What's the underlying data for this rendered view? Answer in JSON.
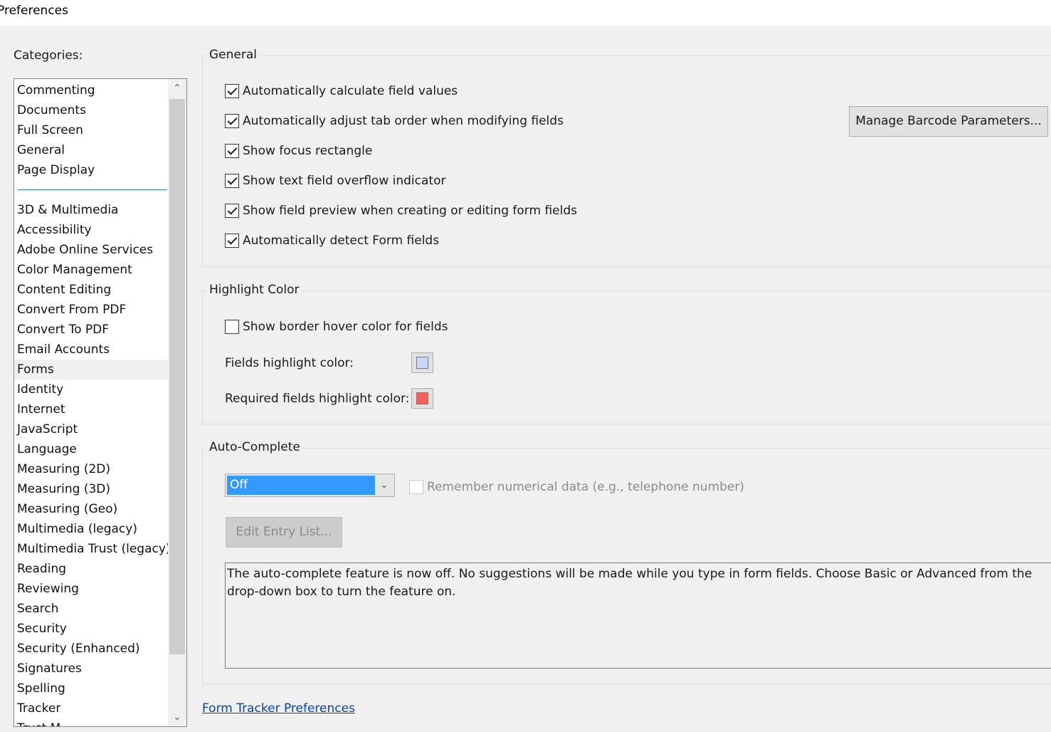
{
  "window": {
    "title": "Preferences"
  },
  "categories": {
    "label": "Categories:",
    "top_items": [
      "Commenting",
      "Documents",
      "Full Screen",
      "General",
      "Page Display"
    ],
    "items": [
      "3D & Multimedia",
      "Accessibility",
      "Adobe Online Services",
      "Color Management",
      "Content Editing",
      "Convert From PDF",
      "Convert To PDF",
      "Email Accounts",
      "Forms",
      "Identity",
      "Internet",
      "JavaScript",
      "Language",
      "Measuring (2D)",
      "Measuring (3D)",
      "Measuring (Geo)",
      "Multimedia (legacy)",
      "Multimedia Trust (legacy)",
      "Reading",
      "Reviewing",
      "Search",
      "Security",
      "Security (Enhanced)",
      "Signatures",
      "Spelling",
      "Tracker",
      "Trust M"
    ],
    "selected": "Forms"
  },
  "general": {
    "title": "General",
    "options": [
      {
        "label": "Automatically calculate field values",
        "checked": true
      },
      {
        "label": "Automatically adjust tab order when modifying fields",
        "checked": true
      },
      {
        "label": "Show focus rectangle",
        "checked": true
      },
      {
        "label": "Show text field overflow indicator",
        "checked": true
      },
      {
        "label": "Show field preview when creating or editing form fields",
        "checked": true
      },
      {
        "label": "Automatically detect Form fields",
        "checked": true
      }
    ],
    "barcode_button": "Manage Barcode Parameters..."
  },
  "highlight": {
    "title": "Highlight Color",
    "hover_label": "Show border hover color for fields",
    "hover_checked": false,
    "fields_label": "Fields highlight color:",
    "fields_color": "#ccd7fb",
    "required_label": "Required fields highlight color:",
    "required_color": "#f26161"
  },
  "autocomplete": {
    "title": "Auto-Complete",
    "selected": "Off",
    "remember_label": "Remember numerical data (e.g., telephone number)",
    "remember_checked": false,
    "edit_button": "Edit Entry List...",
    "description": "The auto-complete feature is now off. No suggestions will be made while you type in form fields. Choose Basic or Advanced from the drop-down box to turn the feature on."
  },
  "footer": {
    "tracker_link": "Form Tracker Preferences"
  },
  "colors": {
    "accent": "#3399ff",
    "link": "#0645ad",
    "separator": "#2e7bcf"
  }
}
